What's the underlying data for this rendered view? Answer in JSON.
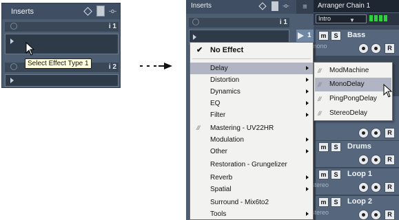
{
  "left_panel": {
    "title": "Inserts",
    "io_label": "-o-",
    "slot1_number": "i 1",
    "slot2_number": "i 2",
    "tooltip": "Select Effect Type 1"
  },
  "right_panel": {
    "inserts_title": "Inserts",
    "io_label": "-o-",
    "slot1_number": "i 1",
    "arranger_chain": "Arranger Chain 1",
    "arranger_select": "Intro",
    "meter_color": "#2fd13a",
    "tracks": [
      {
        "number": "1",
        "name": "Bass",
        "sub": "mono",
        "mute": "m",
        "solo": "S",
        "record": "R"
      },
      {
        "number": "",
        "name": "Drums",
        "sub": "",
        "mute": "m",
        "solo": "S",
        "record": "R"
      },
      {
        "number": "",
        "name": "Loop 1",
        "sub": "stereo",
        "mute": "m",
        "solo": "S",
        "record": "R"
      },
      {
        "number": "",
        "name": "Loop 2",
        "sub": "stereo",
        "mute": "m",
        "solo": "S",
        "record": "R"
      }
    ]
  },
  "context_menu": {
    "items": [
      {
        "label": "No Effect",
        "check": "✔"
      },
      {
        "label": "Delay"
      },
      {
        "label": "Distortion"
      },
      {
        "label": "Dynamics"
      },
      {
        "label": "EQ"
      },
      {
        "label": "Filter"
      },
      {
        "label": "Mastering - UV22HR",
        "plug": "///"
      },
      {
        "label": "Modulation"
      },
      {
        "label": "Other"
      },
      {
        "label": "Restoration - Grungelizer"
      },
      {
        "label": "Reverb"
      },
      {
        "label": "Spatial"
      },
      {
        "label": "Surround - Mix6to2"
      },
      {
        "label": "Tools"
      }
    ],
    "highlight_color": "#b1b4c3"
  },
  "delay_submenu": {
    "items": [
      {
        "label": "ModMachine",
        "plug": "///"
      },
      {
        "label": "MonoDelay",
        "plug": "///"
      },
      {
        "label": "PingPongDelay",
        "plug": "///"
      },
      {
        "label": "StereoDelay",
        "plug": "///"
      }
    ]
  }
}
